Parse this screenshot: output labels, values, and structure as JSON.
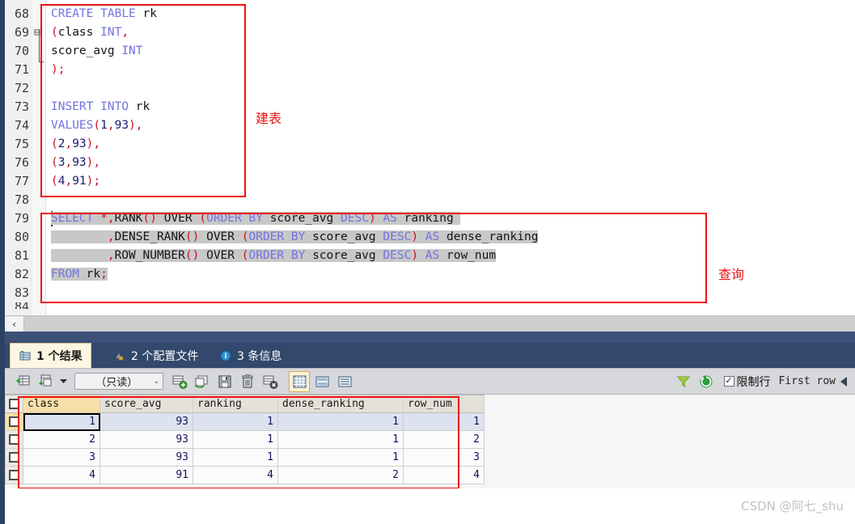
{
  "editor": {
    "first_line_number": 68,
    "lines": [
      {
        "n": 68,
        "text": "CREATE TABLE rk"
      },
      {
        "n": 69,
        "text": "(class INT,"
      },
      {
        "n": 70,
        "text": "score_avg INT"
      },
      {
        "n": 71,
        "text": ");"
      },
      {
        "n": 72,
        "text": ""
      },
      {
        "n": 73,
        "text": "INSERT INTO rk"
      },
      {
        "n": 74,
        "text": "VALUES(1,93),"
      },
      {
        "n": 75,
        "text": "(2,93),"
      },
      {
        "n": 76,
        "text": "(3,93),"
      },
      {
        "n": 77,
        "text": "(4,91);"
      },
      {
        "n": 78,
        "text": ""
      },
      {
        "n": 79,
        "text": "SELECT *,RANK() OVER (ORDER BY score_avg DESC) AS ranking"
      },
      {
        "n": 80,
        "text": "        ,DENSE_RANK() OVER (ORDER BY score_avg DESC) AS dense_ranking"
      },
      {
        "n": 81,
        "text": "        ,ROW_NUMBER() OVER (ORDER BY score_avg DESC) AS row_num"
      },
      {
        "n": 82,
        "text": "FROM rk;"
      },
      {
        "n": 83,
        "text": ""
      }
    ]
  },
  "annotations": [
    {
      "label": "建表",
      "for": "create-table-block"
    },
    {
      "label": "查询",
      "for": "select-query-block"
    }
  ],
  "results_tabs": [
    {
      "label": "1 个结果",
      "icon": "result-grid-icon",
      "active": true
    },
    {
      "label": "2 个配置文件",
      "icon": "profile-icon",
      "active": false
    },
    {
      "label": "3 条信息",
      "icon": "info-icon",
      "active": false
    }
  ],
  "toolbar": {
    "buttons": [
      {
        "name": "import-records-icon",
        "title": "import"
      },
      {
        "name": "export-records-icon",
        "title": "export"
      },
      {
        "name": "dropdown-caret-icon",
        "title": "more"
      },
      {
        "name": "add-row-icon",
        "title": "add row"
      },
      {
        "name": "revert-changes-icon",
        "title": "revert"
      },
      {
        "name": "save-changes-icon",
        "title": "save"
      },
      {
        "name": "delete-row-icon",
        "title": "delete"
      },
      {
        "name": "clear-results-icon",
        "title": "clear"
      },
      {
        "name": "grid-view-icon",
        "title": "grid view"
      },
      {
        "name": "form-view-icon",
        "title": "form view"
      },
      {
        "name": "field-view-icon",
        "title": "field view"
      }
    ],
    "edit_mode": "（只读）",
    "filter_icon": "filter-icon",
    "refresh_icon": "refresh-icon",
    "limit_rows_label": "限制行",
    "limit_rows_checked": true,
    "first_row_label": "First row",
    "nav_prev_icon": "nav-prev-icon"
  },
  "results_grid": {
    "columns": [
      "class",
      "score_avg",
      "ranking",
      "dense_ranking",
      "row_num"
    ],
    "active_column": "class",
    "rows": [
      {
        "class": "1",
        "score_avg": "93",
        "ranking": "1",
        "dense_ranking": "1",
        "row_num": "1"
      },
      {
        "class": "2",
        "score_avg": "93",
        "ranking": "1",
        "dense_ranking": "1",
        "row_num": "2"
      },
      {
        "class": "3",
        "score_avg": "93",
        "ranking": "1",
        "dense_ranking": "1",
        "row_num": "3"
      },
      {
        "class": "4",
        "score_avg": "91",
        "ranking": "4",
        "dense_ranking": "2",
        "row_num": "4"
      }
    ],
    "selected_cell": {
      "row": 0,
      "column": "class"
    }
  },
  "scrollbar": {
    "left_arrow": "‹"
  },
  "watermark": "CSDN @阿七_shu",
  "colors": {
    "keyword": "#7272e0",
    "punctuation": "#cc1122",
    "annotation_red": "#ee1111",
    "tab_active_bg": "#fdf6e3",
    "panel_dark": "#32486c"
  }
}
